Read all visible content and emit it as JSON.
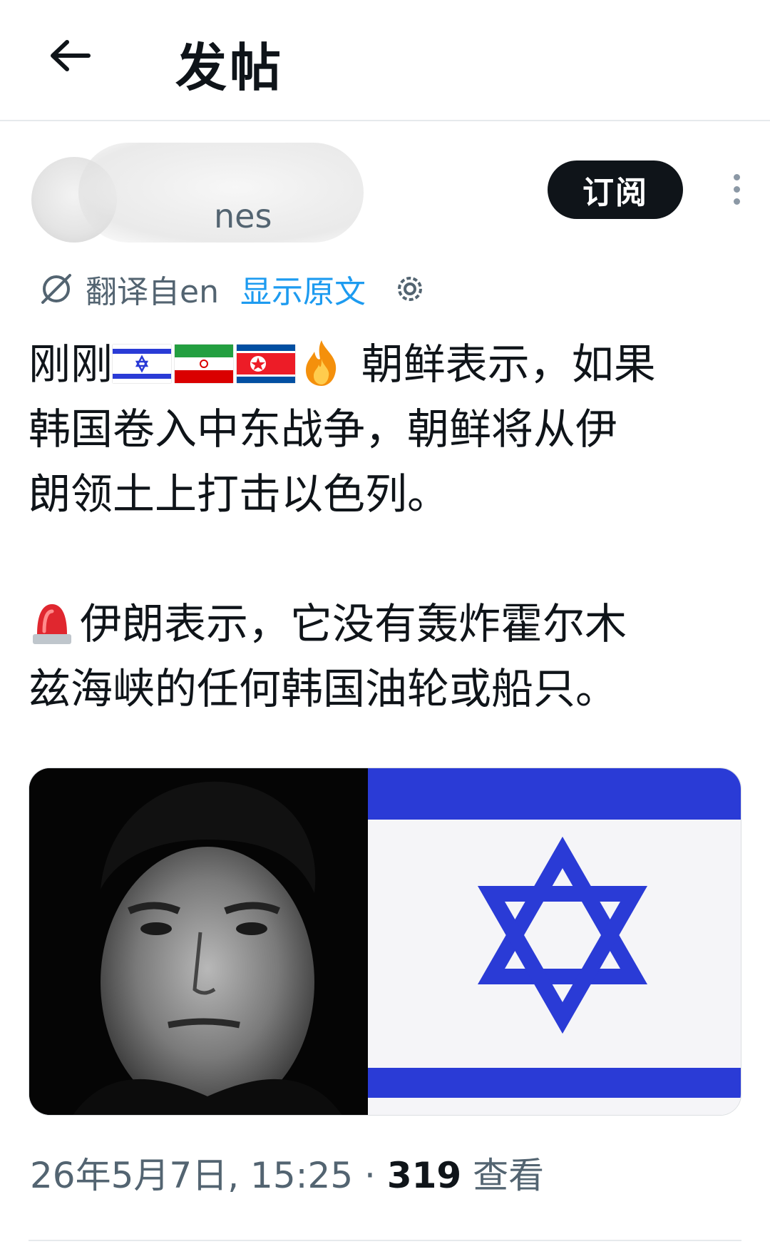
{
  "header": {
    "title": "发帖"
  },
  "author": {
    "handle_visible": "nes",
    "subscribe_label": "订阅"
  },
  "translation": {
    "label": "翻译自en",
    "show_original": "显示原文"
  },
  "post": {
    "line1_prefix": "刚刚",
    "line1_flags": [
      "israel-flag",
      "iran-flag",
      "north-korea-flag",
      "fire-emoji"
    ],
    "line1_suffix": " 朝鲜表示，如果",
    "line2": "韩国卷入中东战争，朝鲜将从伊",
    "line3": "朗领土上打击以色列。",
    "line4_icon": "siren-emoji",
    "line4": "伊朗表示，它没有轰炸霍尔木",
    "line5": "兹海峡的任何韩国油轮或船只。"
  },
  "media": {
    "left_image": "portrait-photo",
    "right_image": "israel-flag"
  },
  "meta": {
    "timestamp": "26年5月7日, 15:25",
    "separator": " · ",
    "view_count": "319",
    "views_label": " 查看"
  },
  "colors": {
    "accent_link": "#1d9bf0",
    "text_primary": "#0f1419",
    "text_secondary": "#536471",
    "flag_blue": "#2a3bd6"
  }
}
